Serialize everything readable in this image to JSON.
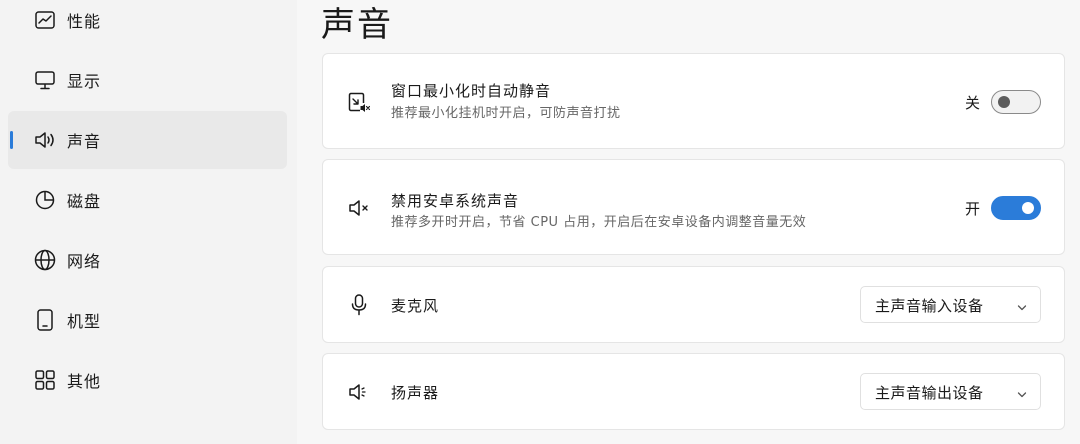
{
  "sidebar": {
    "items": [
      {
        "label": "性能",
        "icon": "performance-chart-icon",
        "active": false
      },
      {
        "label": "显示",
        "icon": "monitor-icon",
        "active": false
      },
      {
        "label": "声音",
        "icon": "speaker-icon",
        "active": true
      },
      {
        "label": "磁盘",
        "icon": "pie-chart-icon",
        "active": false
      },
      {
        "label": "网络",
        "icon": "globe-icon",
        "active": false
      },
      {
        "label": "机型",
        "icon": "phone-icon",
        "active": false
      },
      {
        "label": "其他",
        "icon": "grid-icon",
        "active": false
      }
    ]
  },
  "main": {
    "title": "声音",
    "cards": {
      "minimize_mute": {
        "title": "窗口最小化时自动静音",
        "desc": "推荐最小化挂机时开启，可防声音打扰",
        "state_label": "关",
        "enabled": false,
        "icon": "minimize-mute-icon"
      },
      "disable_android_sound": {
        "title": "禁用安卓系统声音",
        "desc": "推荐多开时开启，节省 CPU 占用，开启后在安卓设备内调整音量无效",
        "state_label": "开",
        "enabled": true,
        "icon": "speaker-mute-icon"
      },
      "microphone": {
        "title": "麦克风",
        "selected": "主声音输入设备",
        "icon": "microphone-icon"
      },
      "speaker": {
        "title": "扬声器",
        "selected": "主声音输出设备",
        "icon": "speaker-icon"
      }
    }
  },
  "colors": {
    "accent": "#2b7cd9",
    "sidebar_bg": "#f3f3f3",
    "card_bg": "#ffffff"
  }
}
